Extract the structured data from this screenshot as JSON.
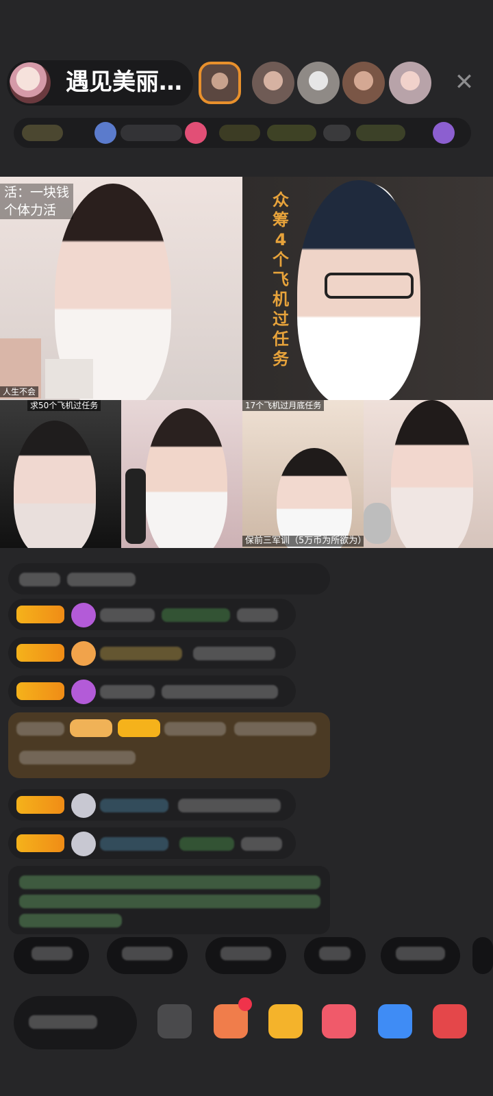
{
  "header": {
    "host_name": "遇见美丽…",
    "close_icon": "close-icon",
    "viewer_count_visible": 5
  },
  "video_grid": {
    "top_left_caption": "活：一块钱\n个体力活",
    "top_left_sub_caption": "人生不会",
    "top_right_vertical_text": "众\n筹\n4\n个\n飞\n机\n过\n任\n务",
    "tile3_caption": "求50个飞机过任务",
    "tile5_caption": "17个飞机过月底任务",
    "tile5_bottom_caption": "保前三军训（5万币为所欲为）"
  },
  "colors": {
    "background": "#262628",
    "accent_orange": "#f5b21b",
    "highlight_text": "#e7a33b"
  }
}
